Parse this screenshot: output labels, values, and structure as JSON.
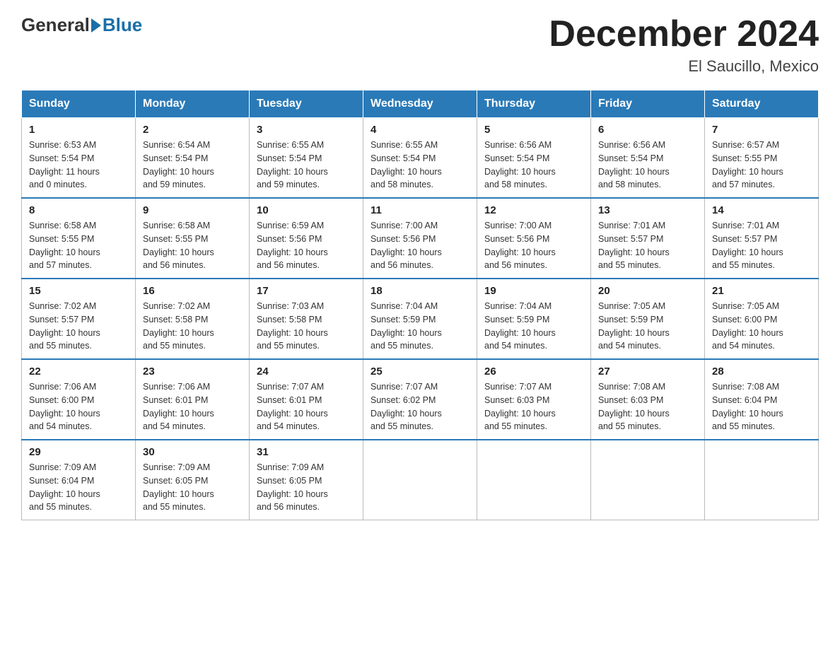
{
  "header": {
    "logo_general": "General",
    "logo_blue": "Blue",
    "title": "December 2024",
    "subtitle": "El Saucillo, Mexico"
  },
  "days_of_week": [
    "Sunday",
    "Monday",
    "Tuesday",
    "Wednesday",
    "Thursday",
    "Friday",
    "Saturday"
  ],
  "weeks": [
    [
      {
        "day": "1",
        "sunrise": "6:53 AM",
        "sunset": "5:54 PM",
        "daylight": "11 hours and 0 minutes."
      },
      {
        "day": "2",
        "sunrise": "6:54 AM",
        "sunset": "5:54 PM",
        "daylight": "10 hours and 59 minutes."
      },
      {
        "day": "3",
        "sunrise": "6:55 AM",
        "sunset": "5:54 PM",
        "daylight": "10 hours and 59 minutes."
      },
      {
        "day": "4",
        "sunrise": "6:55 AM",
        "sunset": "5:54 PM",
        "daylight": "10 hours and 58 minutes."
      },
      {
        "day": "5",
        "sunrise": "6:56 AM",
        "sunset": "5:54 PM",
        "daylight": "10 hours and 58 minutes."
      },
      {
        "day": "6",
        "sunrise": "6:56 AM",
        "sunset": "5:54 PM",
        "daylight": "10 hours and 58 minutes."
      },
      {
        "day": "7",
        "sunrise": "6:57 AM",
        "sunset": "5:55 PM",
        "daylight": "10 hours and 57 minutes."
      }
    ],
    [
      {
        "day": "8",
        "sunrise": "6:58 AM",
        "sunset": "5:55 PM",
        "daylight": "10 hours and 57 minutes."
      },
      {
        "day": "9",
        "sunrise": "6:58 AM",
        "sunset": "5:55 PM",
        "daylight": "10 hours and 56 minutes."
      },
      {
        "day": "10",
        "sunrise": "6:59 AM",
        "sunset": "5:56 PM",
        "daylight": "10 hours and 56 minutes."
      },
      {
        "day": "11",
        "sunrise": "7:00 AM",
        "sunset": "5:56 PM",
        "daylight": "10 hours and 56 minutes."
      },
      {
        "day": "12",
        "sunrise": "7:00 AM",
        "sunset": "5:56 PM",
        "daylight": "10 hours and 56 minutes."
      },
      {
        "day": "13",
        "sunrise": "7:01 AM",
        "sunset": "5:57 PM",
        "daylight": "10 hours and 55 minutes."
      },
      {
        "day": "14",
        "sunrise": "7:01 AM",
        "sunset": "5:57 PM",
        "daylight": "10 hours and 55 minutes."
      }
    ],
    [
      {
        "day": "15",
        "sunrise": "7:02 AM",
        "sunset": "5:57 PM",
        "daylight": "10 hours and 55 minutes."
      },
      {
        "day": "16",
        "sunrise": "7:02 AM",
        "sunset": "5:58 PM",
        "daylight": "10 hours and 55 minutes."
      },
      {
        "day": "17",
        "sunrise": "7:03 AM",
        "sunset": "5:58 PM",
        "daylight": "10 hours and 55 minutes."
      },
      {
        "day": "18",
        "sunrise": "7:04 AM",
        "sunset": "5:59 PM",
        "daylight": "10 hours and 55 minutes."
      },
      {
        "day": "19",
        "sunrise": "7:04 AM",
        "sunset": "5:59 PM",
        "daylight": "10 hours and 54 minutes."
      },
      {
        "day": "20",
        "sunrise": "7:05 AM",
        "sunset": "5:59 PM",
        "daylight": "10 hours and 54 minutes."
      },
      {
        "day": "21",
        "sunrise": "7:05 AM",
        "sunset": "6:00 PM",
        "daylight": "10 hours and 54 minutes."
      }
    ],
    [
      {
        "day": "22",
        "sunrise": "7:06 AM",
        "sunset": "6:00 PM",
        "daylight": "10 hours and 54 minutes."
      },
      {
        "day": "23",
        "sunrise": "7:06 AM",
        "sunset": "6:01 PM",
        "daylight": "10 hours and 54 minutes."
      },
      {
        "day": "24",
        "sunrise": "7:07 AM",
        "sunset": "6:01 PM",
        "daylight": "10 hours and 54 minutes."
      },
      {
        "day": "25",
        "sunrise": "7:07 AM",
        "sunset": "6:02 PM",
        "daylight": "10 hours and 55 minutes."
      },
      {
        "day": "26",
        "sunrise": "7:07 AM",
        "sunset": "6:03 PM",
        "daylight": "10 hours and 55 minutes."
      },
      {
        "day": "27",
        "sunrise": "7:08 AM",
        "sunset": "6:03 PM",
        "daylight": "10 hours and 55 minutes."
      },
      {
        "day": "28",
        "sunrise": "7:08 AM",
        "sunset": "6:04 PM",
        "daylight": "10 hours and 55 minutes."
      }
    ],
    [
      {
        "day": "29",
        "sunrise": "7:09 AM",
        "sunset": "6:04 PM",
        "daylight": "10 hours and 55 minutes."
      },
      {
        "day": "30",
        "sunrise": "7:09 AM",
        "sunset": "6:05 PM",
        "daylight": "10 hours and 55 minutes."
      },
      {
        "day": "31",
        "sunrise": "7:09 AM",
        "sunset": "6:05 PM",
        "daylight": "10 hours and 56 minutes."
      },
      null,
      null,
      null,
      null
    ]
  ],
  "labels": {
    "sunrise": "Sunrise:",
    "sunset": "Sunset:",
    "daylight": "Daylight:"
  }
}
